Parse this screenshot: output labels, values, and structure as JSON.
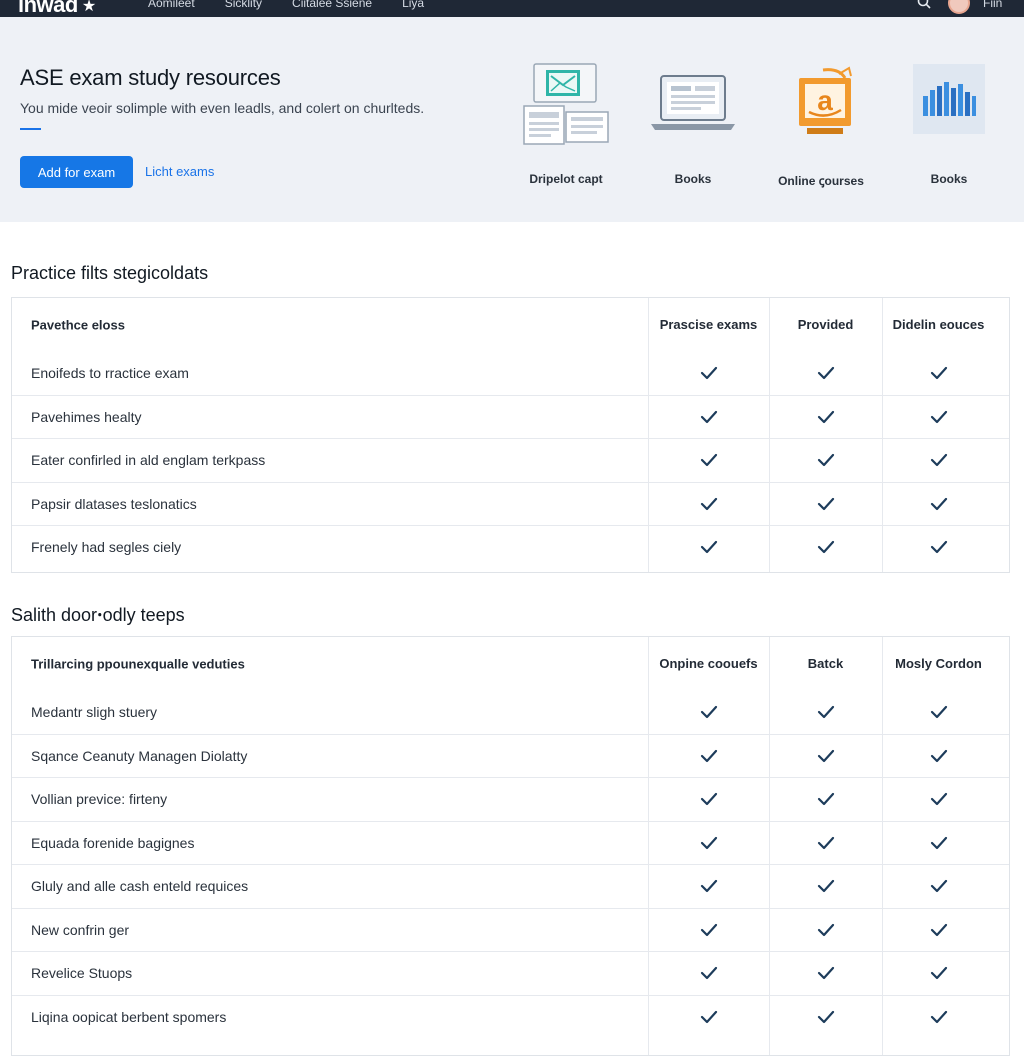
{
  "navbar": {
    "logo": "inwad",
    "links": [
      "Aomileet",
      "Sicklity",
      "Ciitalee Ssiene",
      "Liya"
    ],
    "user": "Fiin"
  },
  "hero": {
    "title": "ASE exam study resources",
    "subtitle": "You mide veoir solimple with even leadls, and colert on churlteds.",
    "primary_button": "Add for exam",
    "secondary_link": "Licht exams",
    "resources": [
      {
        "label": "Dripelot capt",
        "icon": "monitor-docs-icon"
      },
      {
        "label": "Books",
        "icon": "laptop-icon"
      },
      {
        "label": "Online ꞔourses",
        "icon": "amazon-box-icon"
      },
      {
        "label": "Books",
        "icon": "bar-chart-icon"
      }
    ]
  },
  "section1": {
    "title": "Practice filts stegicoldats",
    "header": {
      "label": "Pavethce eloss",
      "cols": [
        "Prascise exams",
        "Provided",
        "Didelin eouces"
      ]
    },
    "rows": [
      "Enoifeds to rractice exam",
      "Pavehimes healty",
      "Eater confirled in ald englam terkpass",
      "Papsir dlatases teslonatics",
      "Frenely had segles ciely"
    ]
  },
  "section2": {
    "title": "Salith doorꞏodly teeps",
    "header": {
      "label": "Trillarcing ppounexqualle veduties",
      "cols": [
        "Onpine coouefs",
        "Batck",
        "Mosly Cordon"
      ]
    },
    "rows": [
      "Medantr sligh stuery",
      "Sqance Ceanuty Managen Diolatty",
      "Vollian previce: firteny",
      "Equada forenide bagignes",
      "Gluly and alle cash enteld requices",
      "New confrin ger",
      "Revelice Stuops",
      "Liqina oopicat berbent spomers"
    ]
  },
  "colors": {
    "accent": "#1677e6",
    "check": "#1d3c5b",
    "navbar": "#1f2836",
    "hero_bg": "#eef1f6"
  }
}
